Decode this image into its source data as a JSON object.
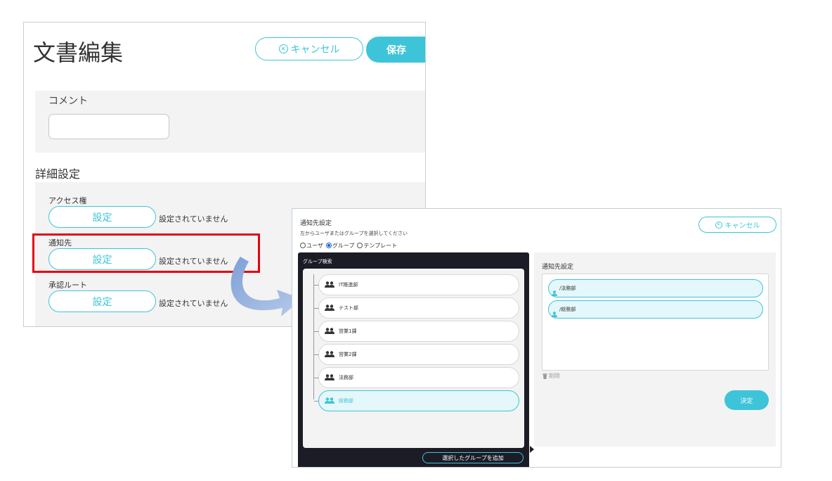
{
  "doc_window": {
    "title": "文書編集",
    "cancel_label": "キャンセル",
    "save_label": "保存",
    "comment": {
      "label": "コメント",
      "value": ""
    },
    "detail_heading": "詳細設定",
    "settings": [
      {
        "label": "アクセス権",
        "button": "設定",
        "status": "設定されていません"
      },
      {
        "label": "通知先",
        "button": "設定",
        "status": "設定されていません"
      },
      {
        "label": "承認ルート",
        "button": "設定",
        "status": "設定されていません"
      }
    ]
  },
  "notify_window": {
    "title": "通知先設定",
    "instruction": "左からユーザまたはグループを選択してください",
    "radio_options": [
      {
        "label": "ユーザ",
        "checked": false
      },
      {
        "label": "グループ",
        "checked": true
      },
      {
        "label": "テンプレート",
        "checked": false
      }
    ],
    "cancel_label": "キャンセル",
    "group_search_label": "グループ検索",
    "groups": [
      {
        "name": "IT推進部",
        "selected": false
      },
      {
        "name": "テスト部",
        "selected": false
      },
      {
        "name": "営業1課",
        "selected": false
      },
      {
        "name": "営業2課",
        "selected": false
      },
      {
        "name": "法務部",
        "selected": false
      },
      {
        "name": "総務部",
        "selected": true
      }
    ],
    "add_group_label": "選択したグループを追加",
    "dest_title": "通知先設定",
    "destinations": [
      {
        "name": "/法務部"
      },
      {
        "name": "/総務部"
      }
    ],
    "delete_label": "削除",
    "decide_label": "決定"
  },
  "colors": {
    "accent": "#3ec4d9",
    "highlight": "#e60012",
    "dark_panel": "#1c1c27",
    "panel_bg": "#f3f3f3"
  }
}
